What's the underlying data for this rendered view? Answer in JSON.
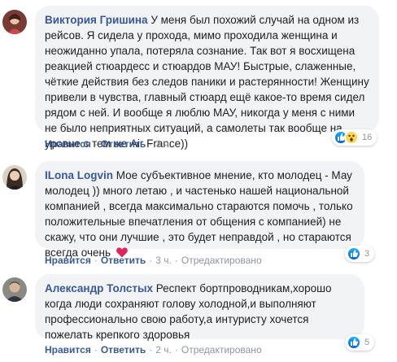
{
  "comments": [
    {
      "author": "Виктория Гришина",
      "text": "У меня был похожий случай на одном из рейсов. Я сидела у прохода, мимо проходила женщина и неожиданно упала, потеряла сознание. Так вот я восхищена реакцией стюардесс и стюардов МАУ! Быстрые, слаженные, чёткие действия без следов паники и растерянности! Женщину привели в чувства, главный стюард ещё какое-то время сидел рядом с ней. И вообще я люблю МАУ, никогда у меня с ними не было неприятных ситуаций, а самолеты так вообще на уровне с тем же Air France))",
      "like_label": "Нравится",
      "reply_label": "Ответить",
      "time": "3 ч.",
      "edited": "",
      "reaction_count": "16",
      "reactions": [
        "like",
        "wow"
      ]
    },
    {
      "author": "ILona Logvin",
      "text": "Мое субъективное мнение, кто молодец - Мау молодец )) много летаю , и частенько нашей национальной компанией , всегда максимально стараются помочь , только положительные впечатления от общения с компанией) не скажу, что они лучшие , это будет неправдой , но стараются всегда очень",
      "like_label": "Нравится",
      "reply_label": "Ответить",
      "time": "3 ч.",
      "edited": "Отредактировано",
      "reaction_count": "3",
      "reactions": [
        "like"
      ]
    },
    {
      "author": "Александр Толстых",
      "text": "Респект бортпроводникам,хорошо когда люди сохраняют голову холодной,и выполняют профессионально свою работу,а интуристу хочется пожелать крепкого здоровья",
      "like_label": "Нравится",
      "reply_label": "Ответить",
      "time": "2 ч.",
      "edited": "Отредактировано",
      "reaction_count": "5",
      "reactions": [
        "like"
      ]
    }
  ],
  "colors": {
    "link": "#385898",
    "bubble": "#f2f3f5",
    "meta": "#90949c",
    "heart": "#e0245e"
  },
  "icons": [
    "heart-emoji",
    "like-reaction-icon",
    "wow-reaction-icon"
  ]
}
